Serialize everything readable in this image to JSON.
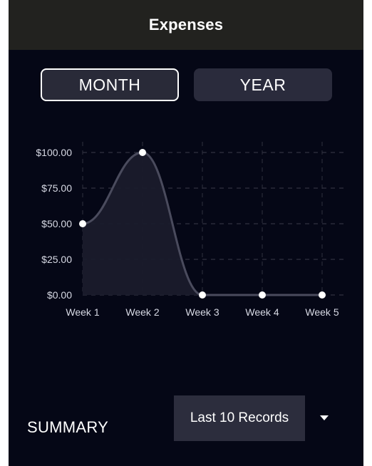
{
  "header": {
    "title": "Expenses"
  },
  "period_toggle": {
    "month_label": "MONTH",
    "year_label": "YEAR",
    "selected": "MONTH"
  },
  "chart_data": {
    "type": "area",
    "categories": [
      "Week 1",
      "Week 2",
      "Week 3",
      "Week 4",
      "Week 5"
    ],
    "values": [
      50,
      100,
      0,
      0,
      0
    ],
    "y_ticks": [
      "$100.00",
      "$75.00",
      "$50.00",
      "$25.00",
      "$0.00"
    ],
    "ylim": [
      0,
      100
    ],
    "grid": true,
    "line_color": "#4a4b5d",
    "fill_color": "#1a1b2b",
    "point_color": "#ffffff"
  },
  "summary": {
    "label": "SUMMARY",
    "dropdown_value": "Last 10 Records"
  },
  "colors": {
    "background": "#050716",
    "header": "#22221f",
    "button": "#2a2b3c",
    "text": "#ffffff"
  }
}
